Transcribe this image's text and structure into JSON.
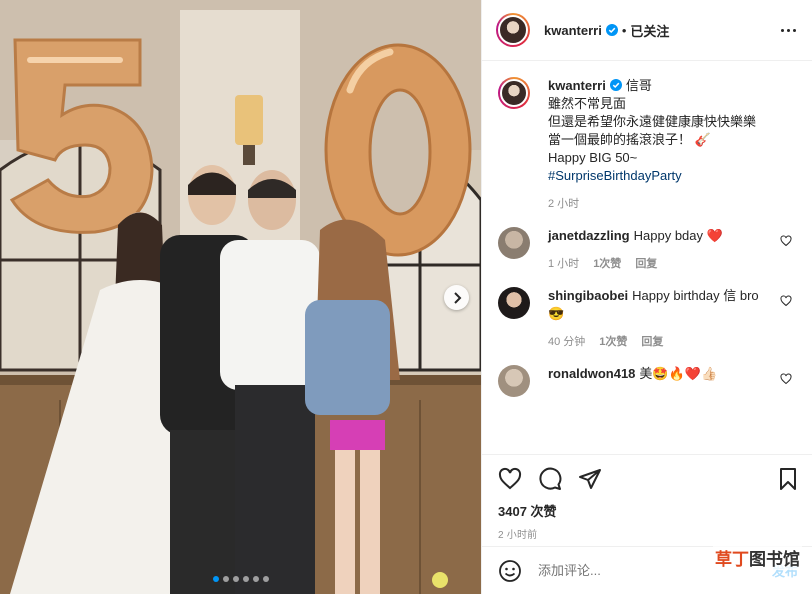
{
  "post": {
    "username": "kwanterri",
    "follow_status": "已关注",
    "caption": {
      "username": "kwanterri",
      "lines": [
        "信哥",
        "雖然不常見面",
        "但還是希望你永遠健健康康快快樂樂",
        "當一個最帥的搖滾浪子！ 🎸",
        "Happy BIG 50~"
      ],
      "hashtag": "#SurpriseBirthdayParty",
      "time": "2 小时"
    },
    "likes": "3407 次赞",
    "posted": "2 小时前"
  },
  "comments": [
    {
      "username": "janetdazzling",
      "text": "Happy bday ❤️",
      "time": "1 小时",
      "likes": "1次赞",
      "reply": "回复"
    },
    {
      "username": "shingibaobei",
      "text": "Happy birthday 信 bro 😎",
      "time": "40 分钟",
      "likes": "1次赞",
      "reply": "回复"
    },
    {
      "username": "ronaldwon418",
      "text": "美🤩🔥❤️👍🏻",
      "time": "",
      "likes": "",
      "reply": ""
    }
  ],
  "add_comment": {
    "placeholder": "添加评论...",
    "post_label": "发布"
  },
  "photo": {
    "balloon_text": "50",
    "slide_count": 6,
    "active_slide": 1
  },
  "watermark": {
    "accent": "草丁",
    "rest": "图书馆"
  },
  "icons": [
    "verified-icon",
    "more-icon",
    "heart-icon",
    "comment-icon",
    "share-icon",
    "bookmark-icon",
    "emoji-icon",
    "chevron-right-icon"
  ],
  "colors": {
    "verified": "#0095f6",
    "link": "#00376b",
    "muted": "#8e8e8e",
    "heart_red": "#ed4956"
  }
}
